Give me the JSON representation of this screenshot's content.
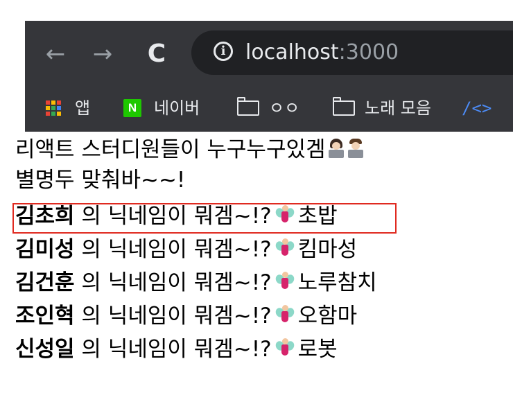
{
  "browser": {
    "back_glyph": "←",
    "forward_glyph": "→",
    "reload_glyph": "C",
    "info_glyph": "i",
    "url_host": "localhost",
    "url_port": ":3000",
    "bookmarks": [
      {
        "label": "앱",
        "icon": "apps-grid-icon"
      },
      {
        "label": "네이버",
        "icon": "naver-icon",
        "icon_text": "N"
      },
      {
        "label": "ㅇㅇ",
        "icon": "folder-icon"
      },
      {
        "label": "노래 모음",
        "icon": "folder-icon"
      },
      {
        "label": "",
        "icon": "code-icon",
        "icon_text": "/<>"
      }
    ],
    "colors": {
      "frame": "#35363a",
      "omnibox": "#202124",
      "naver": "#1ec800",
      "link_icon": "#4c8bf5"
    }
  },
  "page": {
    "intro_line1": "리액트 스터디원들이 누구누구있겜",
    "intro_line2": "별명두 맞춰바~~!",
    "question_text": "의 닉네임이 뭐겜~!?",
    "members": [
      {
        "name": "김초희",
        "nickname": "초밥",
        "highlighted": true
      },
      {
        "name": "김미성",
        "nickname": "킴마성",
        "highlighted": false
      },
      {
        "name": "김건훈",
        "nickname": "노루참치",
        "highlighted": false
      },
      {
        "name": "조인혁",
        "nickname": "오함마",
        "highlighted": false
      },
      {
        "name": "신성일",
        "nickname": "로봇",
        "highlighted": false
      }
    ],
    "icons": [
      "woman-technologist-icon",
      "man-technologist-icon",
      "fairy-icon"
    ],
    "highlight_color": "#e02a20"
  }
}
